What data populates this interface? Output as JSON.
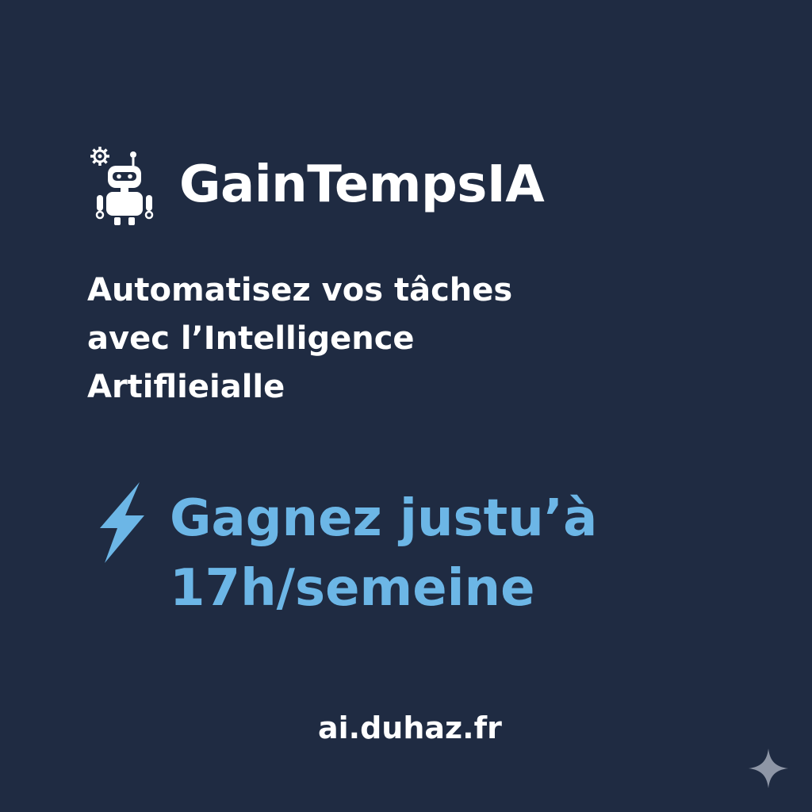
{
  "brand": {
    "name": "GainTempsIA",
    "icon": "robot-gear-icon"
  },
  "tagline": {
    "lines": [
      "Automatisez vos tâches",
      "avec l’Intelligence",
      "Artiflieialle"
    ]
  },
  "promo": {
    "icon": "lightning-bolt-icon",
    "lines": [
      "Gagnez justu’à",
      "17h/semeine"
    ]
  },
  "website": {
    "url": "ai.duhaz.fr"
  },
  "corner_mark": {
    "icon": "sparkle-icon"
  },
  "colors": {
    "background": "#1f2b42",
    "text": "#ffffff",
    "accent": "#6cb6e6"
  }
}
